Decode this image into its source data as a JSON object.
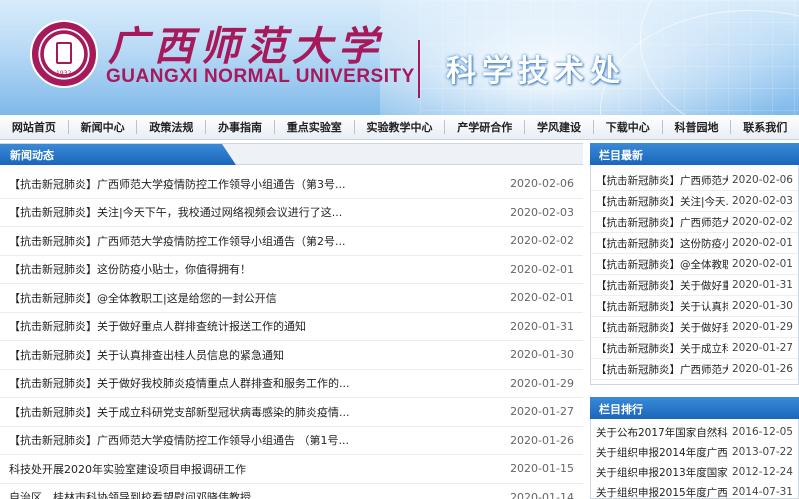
{
  "header": {
    "university_cn": "广西师范大学",
    "university_en": "GUANGXI NORMAL UNIVERSITY",
    "seal_year": "1932",
    "department": "科学技术处"
  },
  "nav": {
    "items": [
      "网站首页",
      "新闻中心",
      "政策法规",
      "办事指南",
      "重点实验室",
      "实验教学中心",
      "产学研合作",
      "学风建设",
      "下载中心",
      "科普园地",
      "联系我们"
    ]
  },
  "news": {
    "section_title": "新闻动态",
    "items": [
      {
        "title": "【抗击新冠肺炎】广西师范大学疫情防控工作领导小组通告（第3号...",
        "date": "2020-02-06"
      },
      {
        "title": "【抗击新冠肺炎】关注|今天下午，我校通过网络视频会议进行了这...",
        "date": "2020-02-03"
      },
      {
        "title": "【抗击新冠肺炎】广西师范大学疫情防控工作领导小组通告（第2号...",
        "date": "2020-02-02"
      },
      {
        "title": "【抗击新冠肺炎】这份防疫小贴士，你值得拥有！",
        "date": "2020-02-01"
      },
      {
        "title": "【抗击新冠肺炎】@全体教职工|这是给您的一封公开信",
        "date": "2020-02-01"
      },
      {
        "title": "【抗击新冠肺炎】关于做好重点人群排查统计报送工作的通知",
        "date": "2020-01-31"
      },
      {
        "title": "【抗击新冠肺炎】关于认真排查出桂人员信息的紧急通知",
        "date": "2020-01-30"
      },
      {
        "title": "【抗击新冠肺炎】关于做好我校肺炎疫情重点人群排查和服务工作的...",
        "date": "2020-01-29"
      },
      {
        "title": "【抗击新冠肺炎】关于成立科研党支部新型冠状病毒感染的肺炎疫情...",
        "date": "2020-01-27"
      },
      {
        "title": "【抗击新冠肺炎】广西师范大学疫情防控工作领导小组通告 （第1号...",
        "date": "2020-01-26"
      },
      {
        "title": "科技处开展2020年实验室建设项目申报调研工作",
        "date": "2020-01-15"
      },
      {
        "title": "自治区、桂林市科协领导到校看望慰问邓晓伟教授",
        "date": "2020-01-14"
      }
    ]
  },
  "latest": {
    "section_title": "栏目最新",
    "items": [
      {
        "title": "【抗击新冠肺炎】广西师范大...",
        "date": "2020-02-06"
      },
      {
        "title": "【抗击新冠肺炎】关注|今天...",
        "date": "2020-02-03"
      },
      {
        "title": "【抗击新冠肺炎】广西师范大...",
        "date": "2020-02-02"
      },
      {
        "title": "【抗击新冠肺炎】这份防疫小...",
        "date": "2020-02-01"
      },
      {
        "title": "【抗击新冠肺炎】@全体教职...",
        "date": "2020-02-01"
      },
      {
        "title": "【抗击新冠肺炎】关于做好重...",
        "date": "2020-01-31"
      },
      {
        "title": "【抗击新冠肺炎】关于认真排...",
        "date": "2020-01-30"
      },
      {
        "title": "【抗击新冠肺炎】关于做好我...",
        "date": "2020-01-29"
      },
      {
        "title": "【抗击新冠肺炎】关于成立科...",
        "date": "2020-01-27"
      },
      {
        "title": "【抗击新冠肺炎】广西师范大...",
        "date": "2020-01-26"
      }
    ]
  },
  "ranking": {
    "section_title": "栏目排行",
    "items": [
      {
        "title": "关于公布2017年国家自然科学...",
        "date": "2016-12-05"
      },
      {
        "title": "关于组织申报2014年度广西高...",
        "date": "2013-07-22"
      },
      {
        "title": "关于组织申报2013年度国家自...",
        "date": "2012-12-24"
      },
      {
        "title": "关于组织申报2015年度广西高...",
        "date": "2014-07-31"
      }
    ]
  },
  "colors": {
    "brand": "#a6195a",
    "accent": "#1a66bb"
  }
}
